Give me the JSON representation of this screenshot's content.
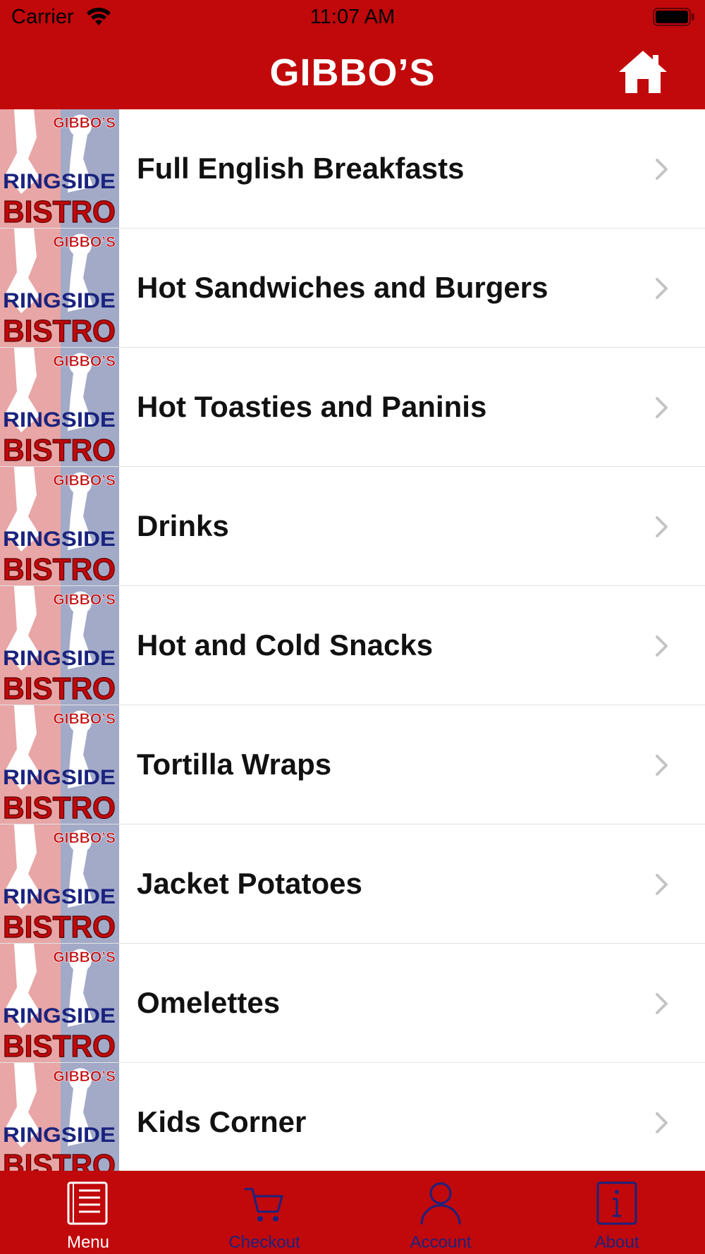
{
  "status_bar": {
    "carrier": "Carrier",
    "time": "11:07 AM",
    "wifi_icon": "wifi-icon",
    "battery_icon": "battery-icon"
  },
  "nav": {
    "title": "GIBBO’S",
    "home_icon": "home-icon"
  },
  "thumbnail": {
    "brand_top": "GIBBO’S",
    "brand_middle": "RINGSIDE",
    "brand_bottom": "BISTRO"
  },
  "menu": {
    "items": [
      {
        "label": "Full English Breakfasts"
      },
      {
        "label": "Hot Sandwiches and Burgers"
      },
      {
        "label": "Hot Toasties and Paninis"
      },
      {
        "label": "Drinks"
      },
      {
        "label": "Hot and Cold Snacks"
      },
      {
        "label": "Tortilla Wraps"
      },
      {
        "label": "Jacket Potatoes"
      },
      {
        "label": "Omelettes"
      },
      {
        "label": "Kids Corner"
      }
    ]
  },
  "tabs": [
    {
      "label": "Menu",
      "icon": "menu-book-icon",
      "active": true
    },
    {
      "label": "Checkout",
      "icon": "cart-icon",
      "active": false
    },
    {
      "label": "Account",
      "icon": "person-icon",
      "active": false
    },
    {
      "label": "About",
      "icon": "info-icon",
      "active": false
    }
  ],
  "colors": {
    "brand_red": "#c1080b",
    "tab_inactive": "#1a237e",
    "tab_active": "#ffffff"
  }
}
